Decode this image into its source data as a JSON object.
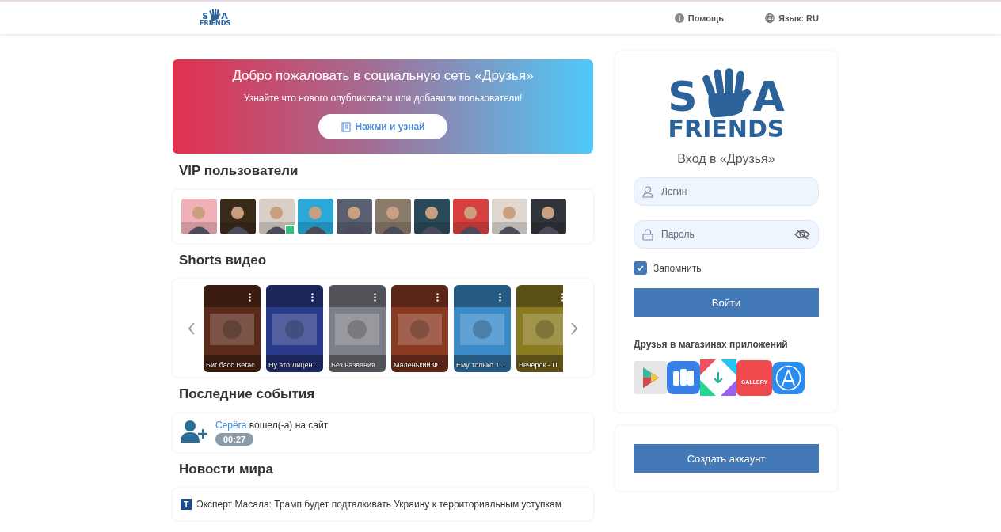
{
  "header": {
    "logo": {
      "letters": [
        "S",
        "A"
      ],
      "word": "FRIENDS"
    },
    "links": [
      {
        "kind": "info",
        "label": "Помощь"
      },
      {
        "kind": "globe",
        "label": "Язык: RU"
      }
    ]
  },
  "banner": {
    "title": "Добро пожаловать в социальную сеть «Друзья»",
    "subtitle": "Узнайте что нового опубликовали или добавили пользователи!",
    "button": "Нажми и узнай"
  },
  "vip": {
    "title": "VIP пользователи",
    "users": [
      {
        "kind": "picture",
        "online": false
      },
      {
        "kind": "picture",
        "online": false
      },
      {
        "kind": "picture",
        "online": true
      },
      {
        "kind": "picture",
        "online": false
      },
      {
        "kind": "picture",
        "online": false
      },
      {
        "kind": "picture",
        "online": false
      },
      {
        "kind": "picture",
        "online": false
      },
      {
        "kind": "picture",
        "online": false
      },
      {
        "kind": "picture",
        "online": false
      },
      {
        "kind": "picture",
        "online": false
      }
    ]
  },
  "shorts": {
    "title": "Shorts видео",
    "videos": [
      {
        "caption": "Биг басс Вегас",
        "color": "#5a2a1a"
      },
      {
        "caption": "Ну это Лицен...",
        "color": "#2a3a8a"
      },
      {
        "caption": "Без названия",
        "color": "#7d8088"
      },
      {
        "caption": "Маленький Ф...",
        "color": "#8a3a22"
      },
      {
        "caption": "Ему только 1 ...",
        "color": "#3a8ac8"
      },
      {
        "caption": "Вечерок - П",
        "color": "#8a7a20"
      }
    ]
  },
  "events": {
    "title": "Последние события",
    "items": [
      {
        "user": "Серёга",
        "text": "вошел(-а) на сайт",
        "time": "00:27"
      }
    ]
  },
  "news": {
    "title": "Новости мира",
    "items": [
      {
        "source": "T",
        "text": "Эксперт Масала: Трамп будет подталкивать Украину к территориальным уступкам"
      }
    ]
  },
  "login": {
    "logo": {
      "letters": [
        "S",
        "A"
      ],
      "word": "FRIENDS"
    },
    "title": "Вход в «Друзья»",
    "login_placeholder": "Логин",
    "password_placeholder": "Пароль",
    "remember": {
      "label": "Запомнить",
      "checked": true
    },
    "submit": "Войти",
    "stores_title": "Друзья в магазинах приложений",
    "stores": [
      {
        "kind": "play"
      },
      {
        "kind": "mi"
      },
      {
        "kind": "kite"
      },
      {
        "kind": "gallery",
        "label": "GALLERY"
      },
      {
        "kind": "appstore"
      }
    ],
    "register": "Создать аккаунт"
  }
}
